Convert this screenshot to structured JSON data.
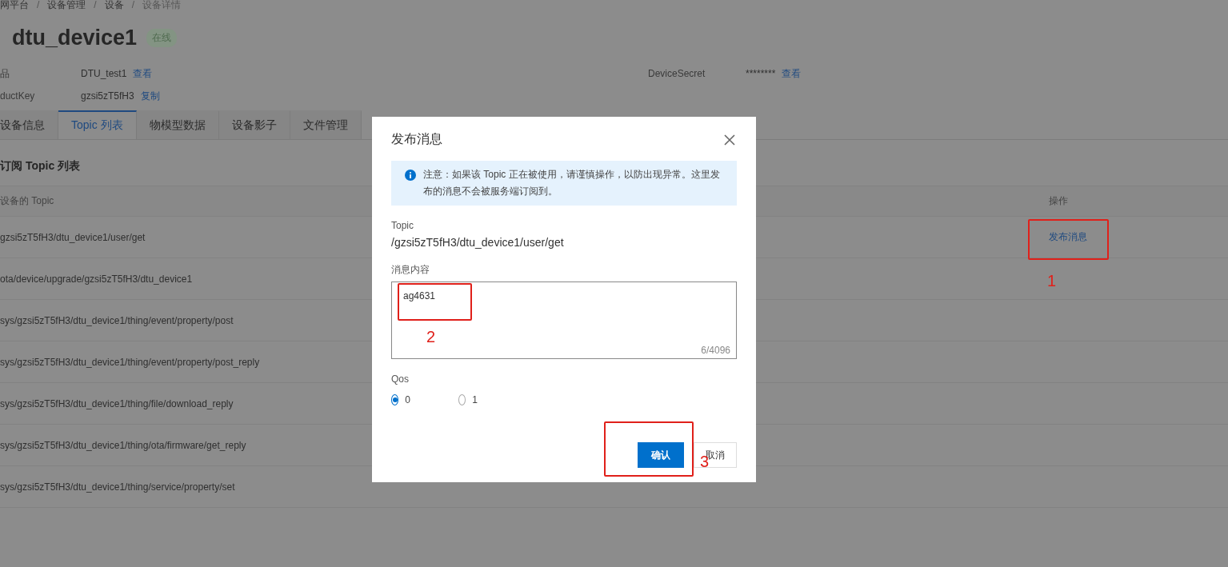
{
  "breadcrumb": [
    "网平台",
    "设备管理",
    "设备",
    "设备详情"
  ],
  "breadcrumb_separator": "/",
  "device": {
    "name": "dtu_device1",
    "status": "在线",
    "online": true
  },
  "info": [
    {
      "label": "品",
      "value": "DTU_test1",
      "link": "查看"
    },
    {
      "label": "DeviceSecret",
      "value": "********",
      "link": "查看"
    },
    {
      "label": "ductKey",
      "value": "gzsi5zT5fH3",
      "link": "复制"
    }
  ],
  "tabs": [
    {
      "label": "设备信息",
      "selected": false
    },
    {
      "label": "Topic 列表",
      "selected": true
    },
    {
      "label": "物模型数据",
      "selected": false
    },
    {
      "label": "设备影子",
      "selected": false
    },
    {
      "label": "文件管理",
      "selected": false
    }
  ],
  "section_title": "订阅 Topic 列表",
  "table": {
    "columns": [
      "设备的 Topic",
      "操作"
    ],
    "rows": [
      {
        "topic": "gzsi5zT5fH3/dtu_device1/user/get",
        "action": "发布消息"
      },
      {
        "topic": "ota/device/upgrade/gzsi5zT5fH3/dtu_device1"
      },
      {
        "topic": "sys/gzsi5zT5fH3/dtu_device1/thing/event/property/post"
      },
      {
        "topic": "sys/gzsi5zT5fH3/dtu_device1/thing/event/property/post_reply"
      },
      {
        "topic": "sys/gzsi5zT5fH3/dtu_device1/thing/file/download_reply"
      },
      {
        "topic": "sys/gzsi5zT5fH3/dtu_device1/thing/ota/firmware/get_reply"
      },
      {
        "topic": "sys/gzsi5zT5fH3/dtu_device1/thing/service/property/set"
      }
    ]
  },
  "dialog": {
    "title": "发布消息",
    "notice": "注意：如果该 Topic 正在被使用，请谨慎操作，以防出现异常。这里发布的消息不会被服务端订阅到。",
    "topic_label": "Topic",
    "topic": "/gzsi5zT5fH3/dtu_device1/user/get",
    "content_label": "消息内容",
    "content": "ag4631",
    "counter": "6/4096",
    "qos_label": "Qos",
    "qos": [
      {
        "label": "0",
        "selected": true
      },
      {
        "label": "1",
        "selected": false
      }
    ],
    "buttons": [
      {
        "label": "确认",
        "kind": "primary"
      },
      {
        "label": "取消",
        "kind": "secondary"
      }
    ]
  },
  "annotations": [
    {
      "label": "1"
    },
    {
      "label": "2"
    },
    {
      "label": "3"
    }
  ]
}
